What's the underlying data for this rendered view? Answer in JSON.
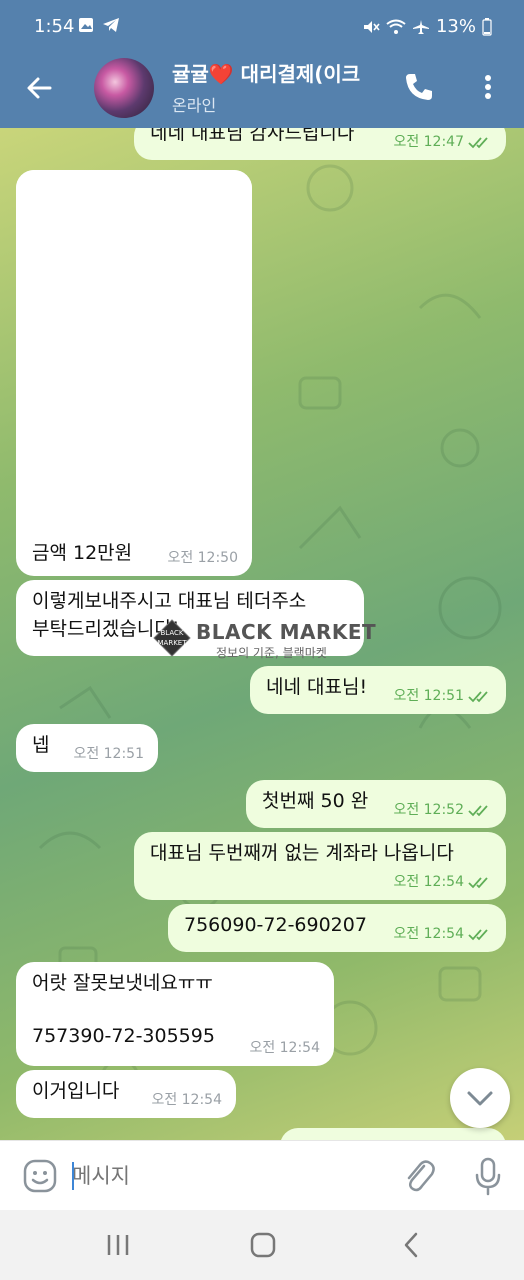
{
  "status": {
    "time": "1:54",
    "battery": "13%"
  },
  "header": {
    "title": "귤귤❤️ 대리결제(이크",
    "subtitle": "온라인"
  },
  "messages": [
    {
      "text": "네네 대표님 감사드립니다",
      "time": "오전 12:47"
    },
    {
      "text": "금액 12만원",
      "time": "오전 12:50"
    },
    {
      "text": "이렇게보내주시고 대표님 테더주소\n부탁드리겠습니다!",
      "time": ""
    },
    {
      "text": "네네 대표님!",
      "time": "오전 12:51"
    },
    {
      "text": "넵",
      "time": "오전 12:51"
    },
    {
      "text": "첫번째 50 완",
      "time": "오전 12:52"
    },
    {
      "text": "대표님 두번째꺼 없는 계좌라 나옵니다",
      "time": "오전 12:54"
    },
    {
      "text": "756090-72-690207",
      "time": "오전 12:54"
    },
    {
      "text": "어랏 잘못보냇네요ㅠㅠ\n\n757390-72-305595",
      "time": "오전 12:54"
    },
    {
      "text": "이거입니다",
      "time": "오전 12:54"
    }
  ],
  "watermark": {
    "title": "BLACK MARKET",
    "subtitle": "정보의 기준, 블랙마켓"
  },
  "composer": {
    "placeholder": "메시지"
  },
  "icons": {
    "back": "arrow-left-icon",
    "call": "phone-icon",
    "more": "more-vertical-icon",
    "emoji": "emoji-icon",
    "attach": "paperclip-icon",
    "mic": "microphone-icon",
    "read": "double-check-icon",
    "scroll": "chevron-down-icon"
  },
  "colors": {
    "header": "#5581ad",
    "outgoing": "#effdde",
    "incoming": "#ffffff",
    "check": "#5fae57"
  }
}
